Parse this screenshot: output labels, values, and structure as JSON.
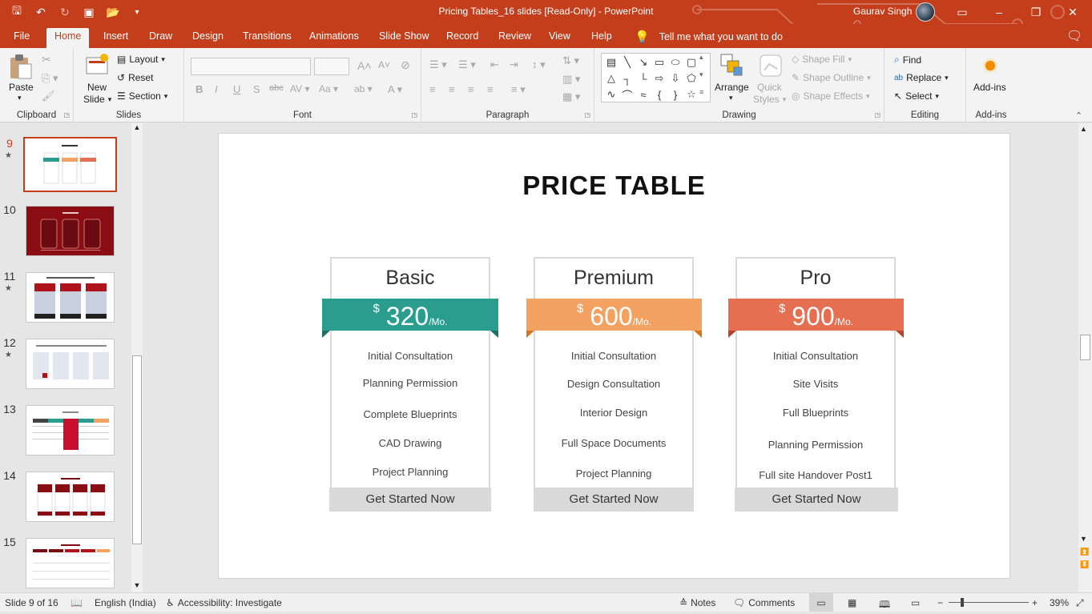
{
  "window": {
    "title": "Pricing Tables_16 slides [Read-Only]  -  PowerPoint",
    "user": "Gaurav Singh"
  },
  "tabs": [
    "File",
    "Home",
    "Insert",
    "Draw",
    "Design",
    "Transitions",
    "Animations",
    "Slide Show",
    "Record",
    "Review",
    "View",
    "Help"
  ],
  "active_tab": "Home",
  "tell_me": "Tell me what you want to do",
  "ribbon": {
    "clipboard": {
      "paste": "Paste",
      "label": "Clipboard"
    },
    "slides": {
      "new_slide_1": "New",
      "new_slide_2": "Slide",
      "layout": "Layout",
      "reset": "Reset",
      "section": "Section",
      "label": "Slides"
    },
    "font": {
      "label": "Font"
    },
    "paragraph": {
      "label": "Paragraph"
    },
    "drawing": {
      "arrange": "Arrange",
      "quick_1": "Quick",
      "quick_2": "Styles",
      "shape_fill": "Shape Fill",
      "shape_outline": "Shape Outline",
      "shape_effects": "Shape Effects",
      "label": "Drawing"
    },
    "editing": {
      "find": "Find",
      "replace": "Replace",
      "select": "Select",
      "label": "Editing"
    },
    "addins": {
      "addins": "Add-ins",
      "label": "Add-ins"
    }
  },
  "thumbnails": [
    {
      "num": "9",
      "star": true,
      "selected": true
    },
    {
      "num": "10",
      "star": false
    },
    {
      "num": "11",
      "star": true
    },
    {
      "num": "12",
      "star": true
    },
    {
      "num": "13",
      "star": false
    },
    {
      "num": "14",
      "star": false
    },
    {
      "num": "15",
      "star": false
    }
  ],
  "slide": {
    "title": "PRICE TABLE",
    "plans": [
      {
        "name": "Basic",
        "currency": "$",
        "price": "320",
        "period": "/Mo.",
        "color": "#2a9d8f",
        "dark": "#1e6f66",
        "features": [
          "Initial Consultation",
          "Planning Permission",
          "Complete Blueprints",
          "CAD Drawing",
          "Project Planning"
        ],
        "cta": "Get Started Now"
      },
      {
        "name": "Premium",
        "currency": "$",
        "price": "600",
        "period": "/Mo.",
        "color": "#f4a261",
        "dark": "#d9731f",
        "features": [
          "Initial Consultation",
          "Design Consultation",
          "Interior Design",
          "Full Space Documents",
          "Project Planning"
        ],
        "cta": "Get Started Now"
      },
      {
        "name": "Pro",
        "currency": "$",
        "price": "900",
        "period": "/Mo.",
        "color": "#e76f51",
        "dark": "#b8452a",
        "features": [
          "Initial Consultation",
          "Site Visits",
          "Full Blueprints",
          "Planning Permission",
          "Full site Handover Post1"
        ],
        "cta": "Get Started Now"
      }
    ]
  },
  "status": {
    "slide_counter": "Slide 9 of 16",
    "language": "English (India)",
    "accessibility": "Accessibility: Investigate",
    "notes": "Notes",
    "comments": "Comments",
    "zoom": "39%"
  },
  "colors": {
    "accent": "#c43e1c"
  }
}
